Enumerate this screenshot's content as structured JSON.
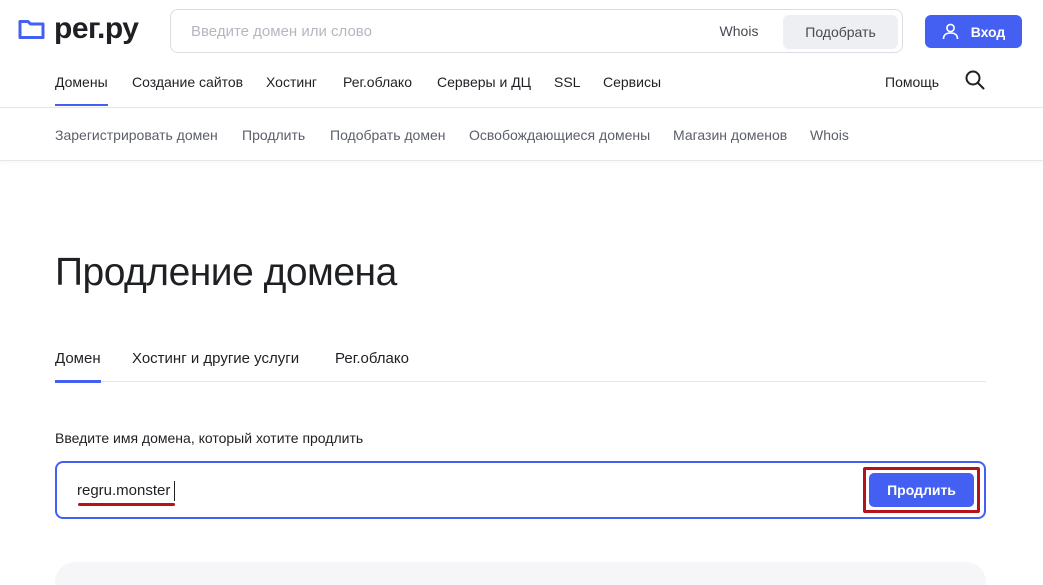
{
  "header": {
    "logo_text": "рег.ру",
    "search_placeholder": "Введите домен или слово",
    "whois_label": "Whois",
    "pick_label": "Подобрать",
    "login_label": "Вход"
  },
  "main_nav": {
    "items": [
      {
        "label": "Домены",
        "active": true
      },
      {
        "label": "Создание сайтов"
      },
      {
        "label": "Хостинг"
      },
      {
        "label": "Рег.облако"
      },
      {
        "label": "Серверы и ДЦ"
      },
      {
        "label": "SSL"
      },
      {
        "label": "Сервисы"
      }
    ],
    "help_label": "Помощь"
  },
  "sub_nav": {
    "items": [
      {
        "label": "Зарегистрировать домен"
      },
      {
        "label": "Продлить"
      },
      {
        "label": "Подобрать домен"
      },
      {
        "label": "Освобождающиеся домены"
      },
      {
        "label": "Магазин доменов"
      },
      {
        "label": "Whois"
      }
    ]
  },
  "content": {
    "title": "Продление домена",
    "tabs": [
      {
        "label": "Домен",
        "active": true
      },
      {
        "label": "Хостинг и другие услуги"
      },
      {
        "label": "Рег.облако"
      }
    ],
    "domain_hint": "Введите имя домена, который хотите продлить",
    "domain_value": "regru.monster",
    "renew_label": "Продлить"
  },
  "colors": {
    "accent": "#4360f2",
    "highlight": "#b5121b"
  },
  "icons": {
    "logo": "folder-icon",
    "login": "user-icon",
    "search": "search-icon"
  }
}
